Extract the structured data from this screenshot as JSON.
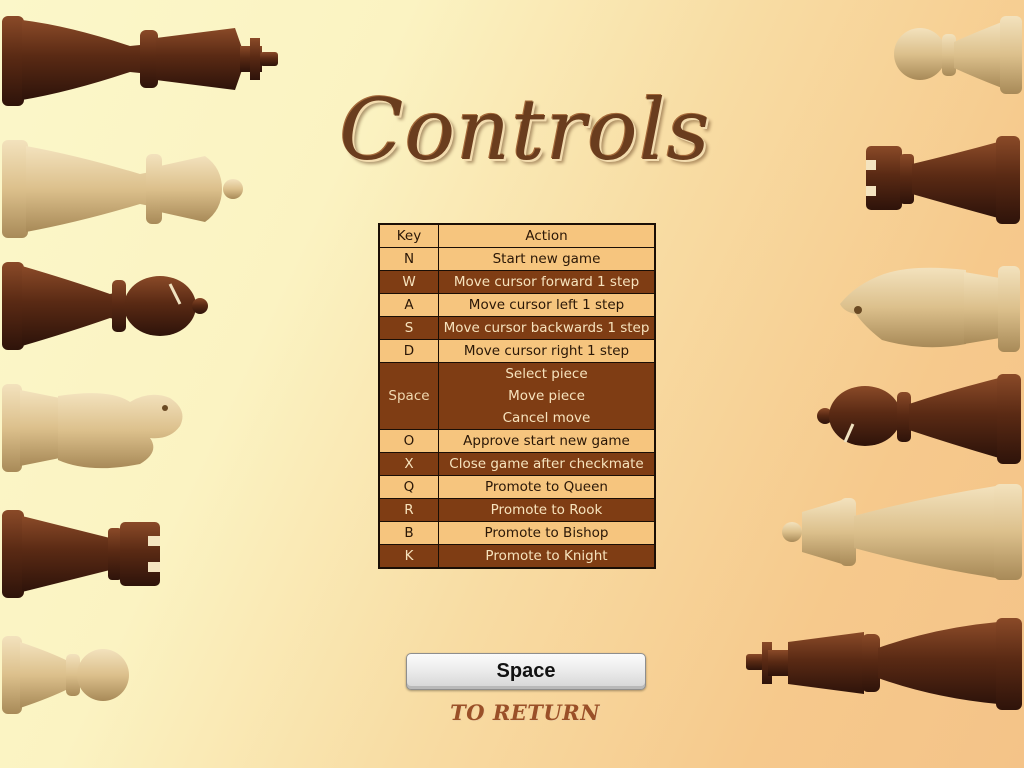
{
  "title": "Controls",
  "table": {
    "header": {
      "key": "Key",
      "action": "Action"
    },
    "rows": [
      {
        "key": "N",
        "action": "Start new game"
      },
      {
        "key": "W",
        "action": "Move cursor forward 1 step"
      },
      {
        "key": "A",
        "action": "Move cursor left 1 step"
      },
      {
        "key": "S",
        "action": "Move cursor backwards 1 step"
      },
      {
        "key": "D",
        "action": "Move cursor right 1 step"
      },
      {
        "key": "Space",
        "actions": [
          "Select piece",
          "Move piece",
          "Cancel move"
        ]
      },
      {
        "key": "O",
        "action": "Approve start new game"
      },
      {
        "key": "X",
        "action": "Close game after checkmate"
      },
      {
        "key": "Q",
        "action": "Promote to Queen"
      },
      {
        "key": "R",
        "action": "Promote to Rook"
      },
      {
        "key": "B",
        "action": "Promote to Bishop"
      },
      {
        "key": "K",
        "action": "Promote to Knight"
      }
    ]
  },
  "return_button": {
    "label": "Space"
  },
  "return_text": "TO RETURN",
  "colors": {
    "light_row": "#f6c57e",
    "dark_row": "#7f3d14",
    "dark_wood": "#5a2a14",
    "light_wood": "#e6cf9e"
  },
  "decor": {
    "left_pieces": [
      "king-icon",
      "queen-icon",
      "bishop-icon",
      "knight-icon",
      "rook-icon",
      "pawn-icon"
    ],
    "right_pieces": [
      "pawn-icon",
      "rook-icon",
      "knight-icon",
      "bishop-icon",
      "queen-icon",
      "king-icon"
    ]
  }
}
